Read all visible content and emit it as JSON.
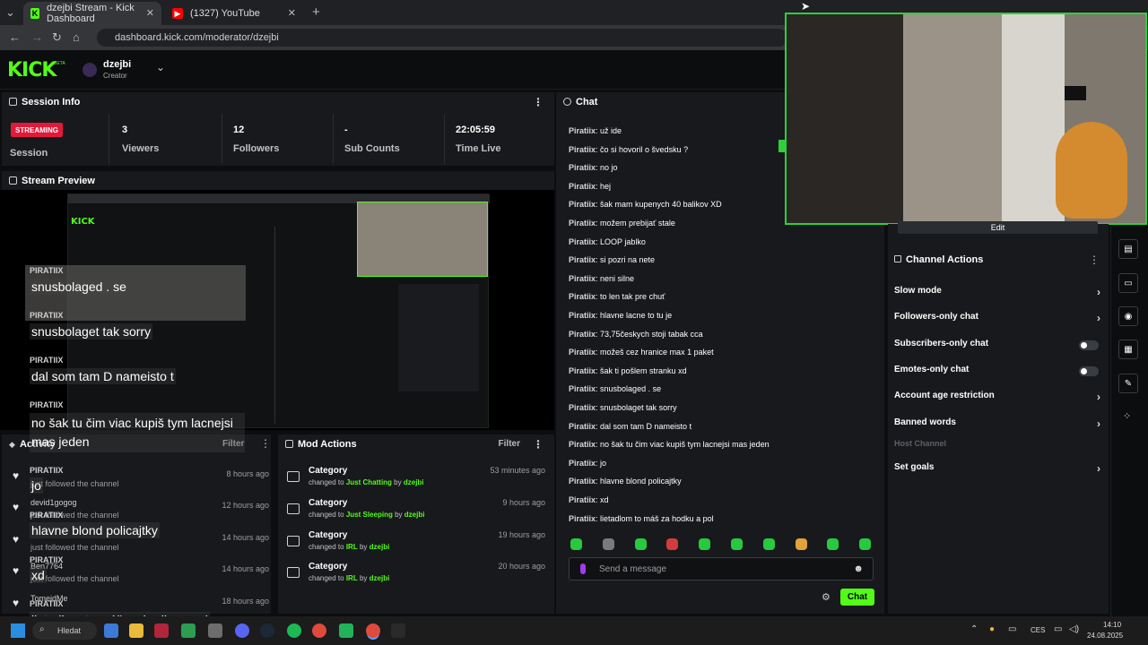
{
  "browser": {
    "tabs": [
      {
        "title": "dzejbi Stream - Kick Dashboard",
        "active": true
      },
      {
        "title": "(1327) YouTube",
        "active": false
      }
    ],
    "url": "dashboard.kick.com/moderator/dzejbi",
    "new_tab": "+"
  },
  "header": {
    "logo": "KICK",
    "logo_tag": "BETA",
    "username": "dzejbi",
    "role": "Creator"
  },
  "session_info": {
    "title": "Session Info",
    "badge": "STREAMING",
    "session_label": "Session",
    "stats": [
      {
        "value": "3",
        "label": "Viewers"
      },
      {
        "value": "12",
        "label": "Followers"
      },
      {
        "value": "-",
        "label": "Sub Counts"
      },
      {
        "value": "22:05:59",
        "label": "Time Live"
      }
    ]
  },
  "stream_preview": {
    "title": "Stream Preview"
  },
  "overlay_chat": [
    {
      "user": "PIRATIIX",
      "msg": "snusbolaged . se"
    },
    {
      "user": "PIRATIIX",
      "msg": "snusbolaget tak sorry"
    },
    {
      "user": "PIRATIIX",
      "msg": "dal som tam D nameisto t"
    },
    {
      "user": "PIRATIIX",
      "msg": "no šak tu čim viac kupiš tym lacnejsi mas jeden"
    },
    {
      "user": "PIRATIIX",
      "msg": "jo"
    },
    {
      "user": "PIRATIIX",
      "msg": "hlavne blond policajtky"
    },
    {
      "user": "PIRATIIX",
      "msg": "xd"
    },
    {
      "user": "PIRATIIX",
      "msg": "lietadlom to máš za hodku a pol"
    }
  ],
  "activity": {
    "title": "Activity",
    "filter": "Filter",
    "rows": [
      {
        "name": "",
        "sub": "just followed the channel",
        "time": "8 hours ago"
      },
      {
        "name": "devid1gogog",
        "sub": "just followed the channel",
        "time": "12 hours ago"
      },
      {
        "name": "",
        "sub": "just followed the channel",
        "time": "14 hours ago"
      },
      {
        "name": "Ben7764",
        "sub": "just followed the channel",
        "time": "14 hours ago"
      },
      {
        "name": "TomeidMe",
        "sub": "",
        "time": "18 hours ago"
      }
    ]
  },
  "mod_actions": {
    "title": "Mod Actions",
    "filter": "Filter",
    "rows": [
      {
        "title": "Category",
        "changed": "changed to",
        "value": "Just Chatting",
        "by": "by",
        "user": "dzejbi",
        "time": "53 minutes ago"
      },
      {
        "title": "Category",
        "changed": "changed to",
        "value": "Just Sleeping",
        "by": "by",
        "user": "dzejbi",
        "time": "9 hours ago"
      },
      {
        "title": "Category",
        "changed": "changed to",
        "value": "IRL",
        "by": "by",
        "user": "dzejbi",
        "time": "19 hours ago"
      },
      {
        "title": "Category",
        "changed": "changed to",
        "value": "IRL",
        "by": "by",
        "user": "dzejbi",
        "time": "20 hours ago"
      }
    ]
  },
  "chat": {
    "title": "Chat",
    "messages": [
      {
        "user": "Piratiix",
        "text": "už ide"
      },
      {
        "user": "Piratiix",
        "text": "čo si hovoril o švedsku ?"
      },
      {
        "user": "Piratiix",
        "text": "no jo"
      },
      {
        "user": "Piratiix",
        "text": "hej"
      },
      {
        "user": "Piratiix",
        "text": "šak mam kupenych 40 balikov XD"
      },
      {
        "user": "Piratiix",
        "text": "možem prebijať stale"
      },
      {
        "user": "Piratiix",
        "text": "LOOP jablko"
      },
      {
        "user": "Piratiix",
        "text": "si pozri na nete"
      },
      {
        "user": "Piratiix",
        "text": "neni silne"
      },
      {
        "user": "Piratiix",
        "text": "to len tak pre chuť"
      },
      {
        "user": "Piratiix",
        "text": "hlavne lacne to tu je"
      },
      {
        "user": "Piratiix",
        "text": "73,75českych stoji tabak cca"
      },
      {
        "user": "Piratiix",
        "text": "možeš cez hranice max 1 paket"
      },
      {
        "user": "Piratiix",
        "text": "šak ti pošlem stranku xd"
      },
      {
        "user": "Piratiix",
        "text": "snusbolaged . se"
      },
      {
        "user": "Piratiix",
        "text": "snusbolaget tak sorry"
      },
      {
        "user": "Piratiix",
        "text": "dal som tam D nameisto t"
      },
      {
        "user": "Piratiix",
        "text": "no šak tu čim viac kupiš tym lacnejsi mas jeden"
      },
      {
        "user": "Piratiix",
        "text": "jo"
      },
      {
        "user": "Piratiix",
        "text": "hlavne blond policajtky"
      },
      {
        "user": "Piratiix",
        "text": "xd"
      },
      {
        "user": "Piratiix",
        "text": "lietadlom to máš za hodku a pol"
      }
    ],
    "input_placeholder": "Send a message",
    "send_label": "Chat"
  },
  "channel_actions": {
    "edit_label": "Edit",
    "title": "Channel Actions",
    "rows": [
      {
        "label": "Slow mode",
        "kind": "chevron"
      },
      {
        "label": "Followers-only chat",
        "kind": "chevron"
      },
      {
        "label": "Subscribers-only chat",
        "kind": "toggle"
      },
      {
        "label": "Emotes-only chat",
        "kind": "toggle"
      },
      {
        "label": "Account age restriction",
        "kind": "chevron"
      },
      {
        "label": "Banned words",
        "kind": "chevron"
      },
      {
        "label": "Host Channel",
        "kind": "disabled"
      },
      {
        "label": "Set goals",
        "kind": "chevron"
      }
    ]
  },
  "taskbar": {
    "search": "Hledat",
    "lang": "CES",
    "time": "14:10",
    "date": "24.08.2025"
  },
  "colors": {
    "accent": "#53fc18",
    "live": "#e3193a",
    "panel": "#18191c"
  }
}
